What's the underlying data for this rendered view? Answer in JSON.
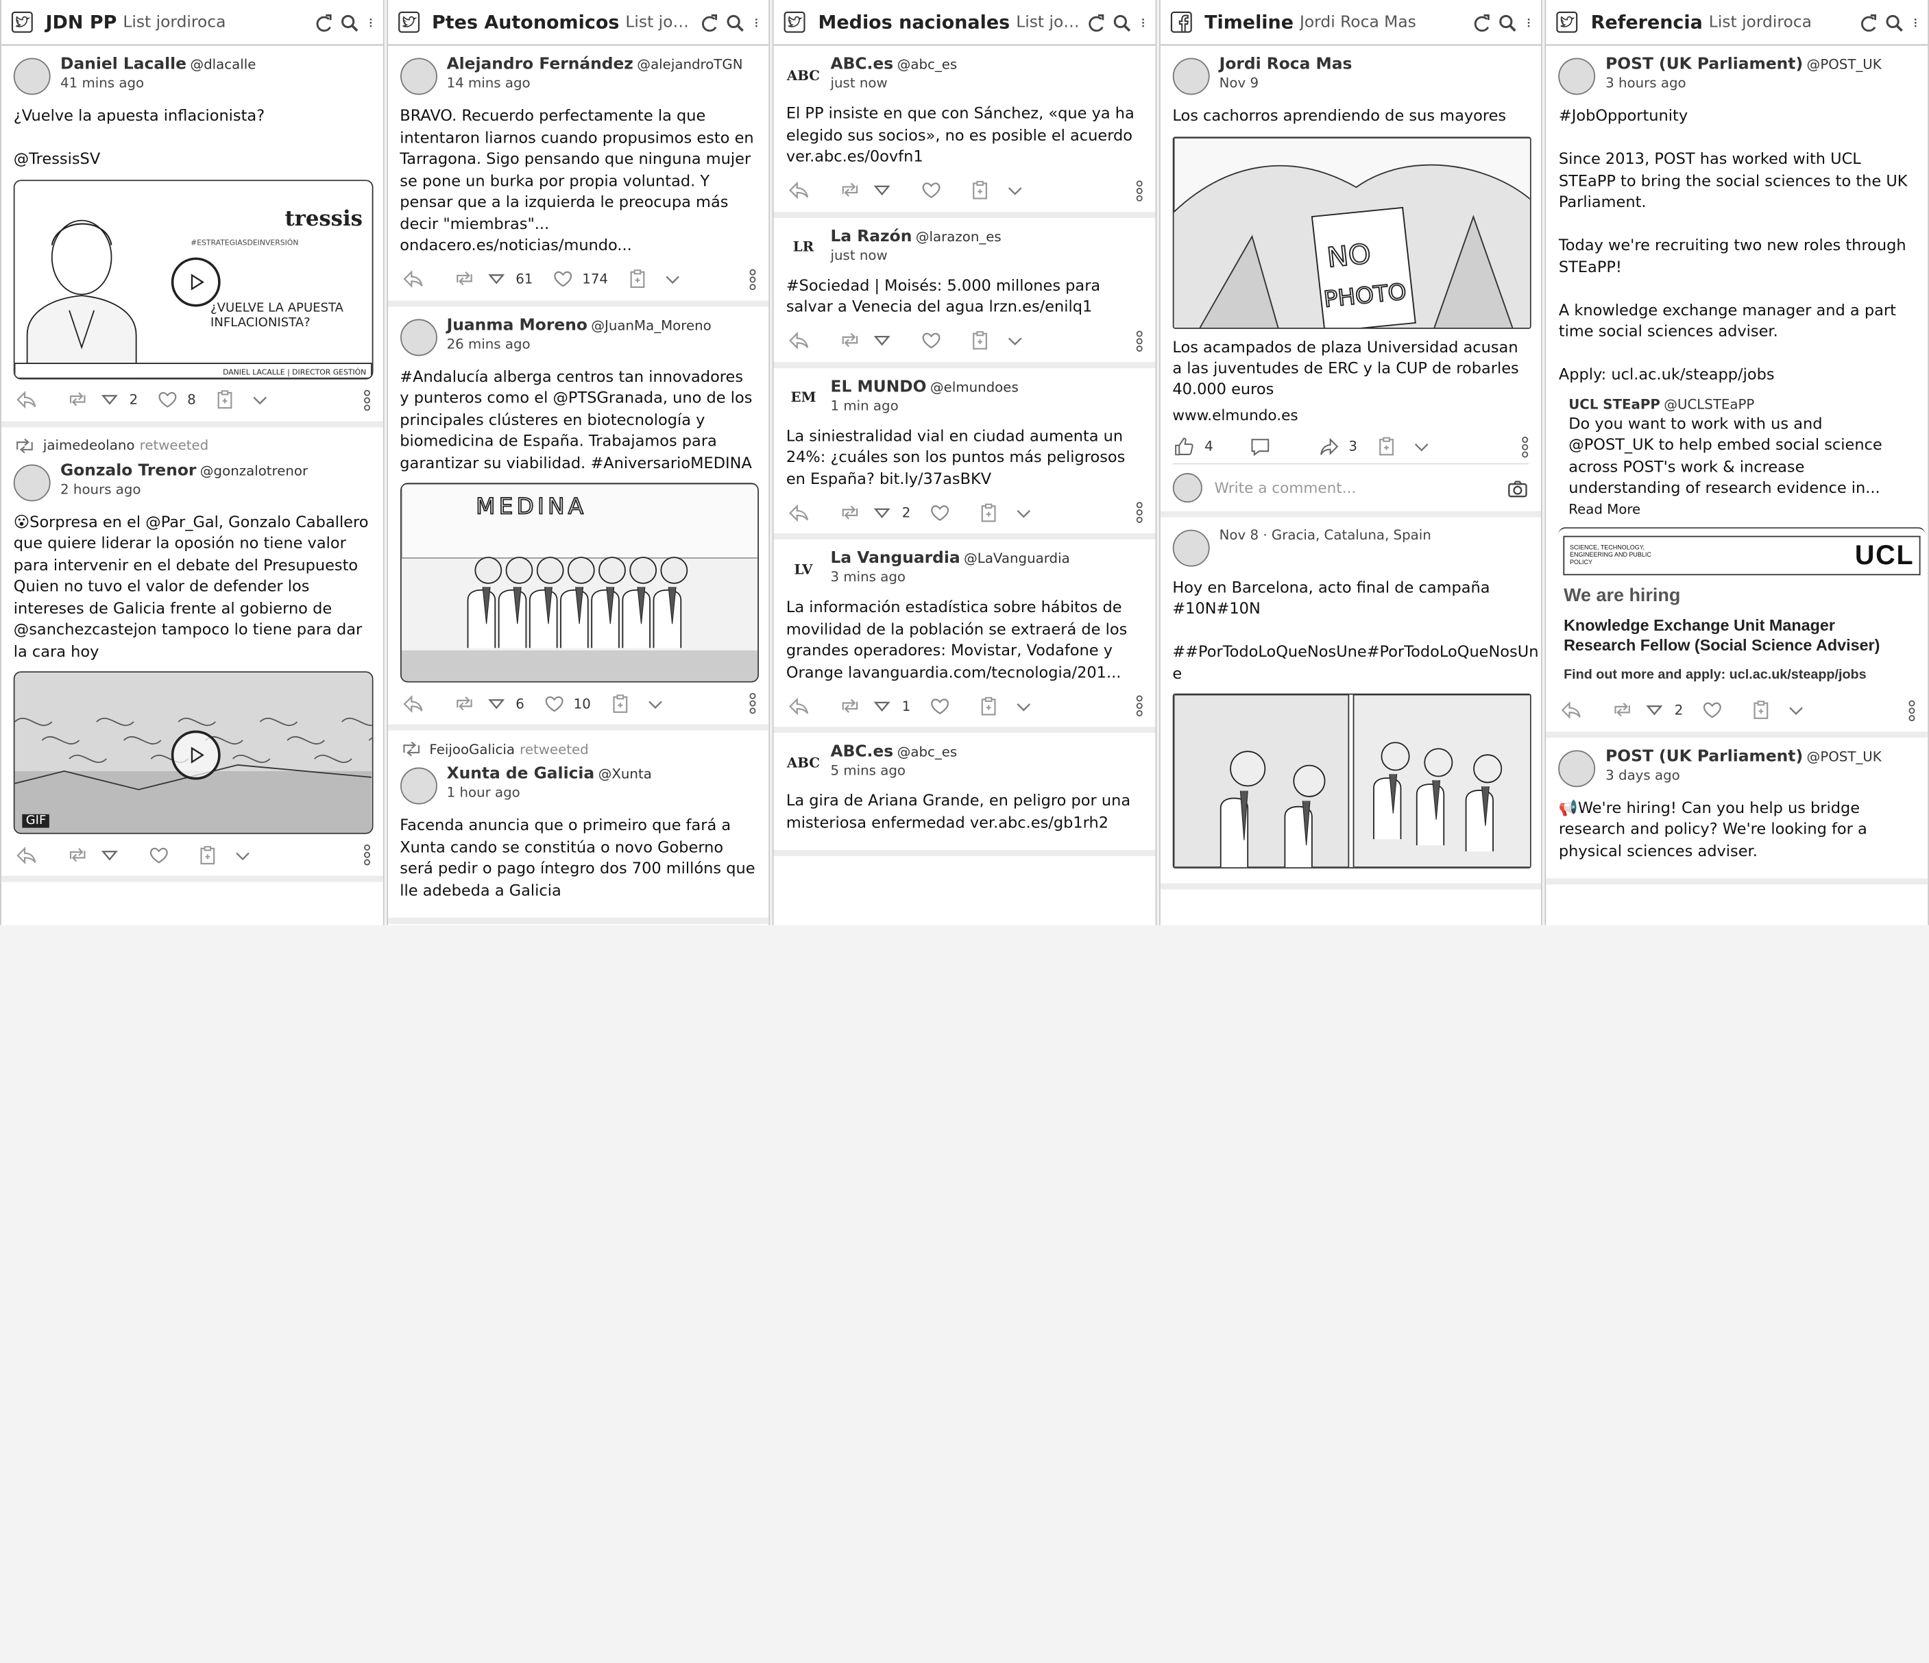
{
  "columns": [
    {
      "network": "twitter",
      "title": "JDN PP",
      "subtitle": "List jordiroca",
      "posts": [
        {
          "author": "Daniel Lacalle",
          "handle": "@dlacalle",
          "time": "41 mins ago",
          "text": "¿Vuelve la apuesta inflacionista?\n\n@TressisSV",
          "media": {
            "kind": "video",
            "brand": "tressis",
            "caption": "¿VUELVE LA APUESTA INFLACIONISTA?",
            "hashtag": "#ESTRATEGIASDEINVERSIÓN",
            "footer": "DANIEL LACALLE | DIRECTOR GESTIÓN"
          },
          "stats": {
            "retweets": "",
            "votes": "2",
            "likes": "8"
          }
        },
        {
          "retweeted_by": "jaimedeolano",
          "retweeted_label": "retweeted",
          "author": "Gonzalo Trenor",
          "handle": "@gonzalotrenor",
          "time": "2 hours ago",
          "text": "😮Sorpresa en el @Par_Gal, Gonzalo Caballero que quiere liderar la oposión no tiene valor para intervenir en el debate del Presupuesto\nQuien no tuvo el valor de defender los intereses de Galicia frente al gobierno de @sanchezcastejon tampoco lo tiene para dar la cara hoy",
          "media": {
            "kind": "gif",
            "badge": "GIF"
          },
          "stats": {
            "retweets": "",
            "votes": "",
            "likes": ""
          }
        }
      ]
    },
    {
      "network": "twitter",
      "title": "Ptes Autonomicos",
      "subtitle": "List jordiroca",
      "posts": [
        {
          "author": "Alejandro Fernández",
          "handle": "@alejandroTGN",
          "time": "14 mins ago",
          "text": "BRAVO. Recuerdo perfectamente la que intentaron liarnos cuando propusimos esto en Tarragona. Sigo pensando que ninguna mujer se pone un burka por propia voluntad. Y pensar que a la izquierda le preocupa más decir \"miembras\"... ondacero.es/noticias/mundo...",
          "stats": {
            "retweets": "",
            "votes": "61",
            "likes": "174"
          }
        },
        {
          "author": "Juanma Moreno",
          "handle": "@JuanMa_Moreno",
          "time": "26 mins ago",
          "text": "#Andalucía alberga centros tan innovadores y punteros como el @PTSGranada, uno de los principales clústeres en biotecnología y biomedicina de España. Trabajamos para garantizar su viabilidad. #AniversarioMEDINA",
          "media": {
            "kind": "photo",
            "sign": "MEDINA"
          },
          "stats": {
            "retweets": "",
            "votes": "6",
            "likes": "10"
          }
        },
        {
          "retweeted_by": "FeijooGalicia",
          "retweeted_label": "retweeted",
          "author": "Xunta de Galicia",
          "handle": "@Xunta",
          "time": "1 hour ago",
          "text": "Facenda anuncia que o primeiro que fará a Xunta cando se constitúa o novo Goberno será pedir o pago íntegro dos 700 millóns que lle adebeda a Galicia"
        }
      ]
    },
    {
      "network": "twitter",
      "title": "Medios nacionales",
      "subtitle": "List jordiroca",
      "posts": [
        {
          "author": "ABC.es",
          "handle": "@abc_es",
          "time": "just now",
          "logo": "ABC",
          "text": "El PP insiste en que con Sánchez, «que ya ha elegido sus socios», no es posible el acuerdo ver.abc.es/0ovfn1",
          "stats": {
            "retweets": "",
            "votes": "",
            "likes": ""
          }
        },
        {
          "author": "La Razón",
          "handle": "@larazon_es",
          "time": "just now",
          "logo": "LR",
          "text": "#Sociedad | Moisés: 5.000 millones para salvar a Venecia del agua lrzn.es/enilq1",
          "stats": {
            "retweets": "",
            "votes": "",
            "likes": ""
          }
        },
        {
          "author": "EL MUNDO",
          "handle": "@elmundoes",
          "time": "1 min ago",
          "logo": "EM",
          "text": "La siniestralidad vial en ciudad aumenta un 24%: ¿cuáles son los puntos más peligrosos en España? bit.ly/37asBKV",
          "stats": {
            "retweets": "",
            "votes": "2",
            "likes": ""
          }
        },
        {
          "author": "La Vanguardia",
          "handle": "@LaVanguardia",
          "time": "3 mins ago",
          "logo": "LV",
          "text": "La información estadística sobre hábitos de movilidad de la población se extraerá de los grandes operadores: Movistar, Vodafone y Orange lavanguardia.com/tecnologia/201...",
          "stats": {
            "retweets": "",
            "votes": "1",
            "likes": ""
          }
        },
        {
          "author": "ABC.es",
          "handle": "@abc_es",
          "time": "5 mins ago",
          "logo": "ABC",
          "text": "La gira de Ariana Grande, en peligro por una misteriosa enfermedad ver.abc.es/gb1rh2"
        }
      ]
    },
    {
      "network": "facebook",
      "title": "Timeline",
      "subtitle": "Jordi Roca Mas",
      "posts": [
        {
          "author": "Jordi Roca Mas",
          "time": "Nov 9",
          "text": "Los cachorros aprendiendo de sus mayores",
          "media": {
            "kind": "photo",
            "sign": "NO PHOTO"
          },
          "link_title": "Los acampados de plaza Universidad acusan a las juventudes de ERC y la CUP de robarles 40.000 euros",
          "link_domain": "www.elmundo.es",
          "stats": {
            "likes": "4",
            "comments": "",
            "shares": "3"
          },
          "comment_placeholder": "Write a comment..."
        },
        {
          "time": "Nov 8 · Gracia, Cataluna, Spain",
          "text": "Hoy en Barcelona, acto final de campaña #10N#10N\n\n##PorTodoLoQueNosUne#PorTodoLoQueNosUn e",
          "media": {
            "kind": "photo-grid"
          }
        }
      ]
    },
    {
      "network": "twitter",
      "title": "Referencia",
      "subtitle": "List jordiroca",
      "posts": [
        {
          "author": "POST (UK Parliament)",
          "handle": "@POST_UK",
          "time": "3 hours ago",
          "text": "#JobOpportunity\n\nSince 2013, POST has worked with UCL STEaPP to bring the social sciences to the UK Parliament.\n\nToday we're recruiting two new roles through STEaPP!\n\nA knowledge exchange manager and a part time social sciences adviser.\n\nApply: ucl.ac.uk/steapp/jobs",
          "quote": {
            "author": "UCL STEaPP",
            "handle": "@UCLSTEaPP",
            "text": "Do you want to work with us and @POST_UK to help embed social science across POST's work & increase understanding of research evidence in...",
            "read_more": "Read More"
          },
          "hiring": {
            "logo": "UCL",
            "dept": "SCIENCE, TECHNOLOGY, ENGINEERING AND PUBLIC POLICY",
            "heading": "We are hiring",
            "role1": "Knowledge Exchange Unit Manager",
            "role2": "Research Fellow (Social Science Adviser)",
            "apply": "Find out more and apply: ucl.ac.uk/steapp/jobs"
          },
          "stats": {
            "retweets": "",
            "votes": "2",
            "likes": ""
          }
        },
        {
          "author": "POST (UK Parliament)",
          "handle": "@POST_UK",
          "time": "3 days ago",
          "text": "📢We're hiring! Can you help us bridge research and policy? We're looking for a physical sciences adviser."
        }
      ]
    }
  ]
}
